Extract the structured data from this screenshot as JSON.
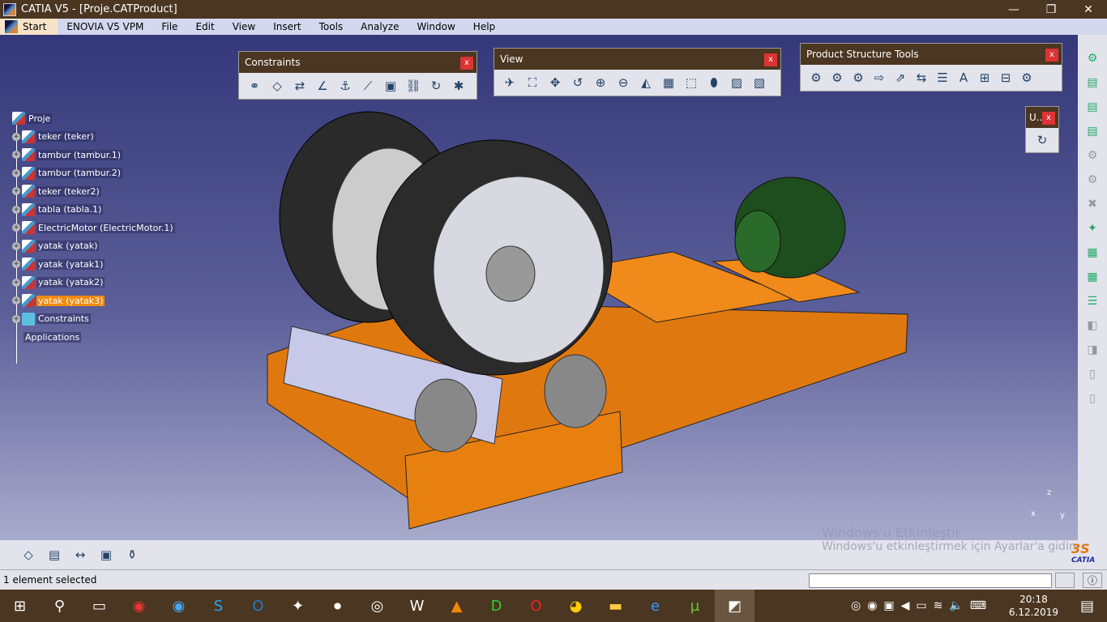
{
  "window": {
    "title": "CATIA V5 - [Proje.CATProduct]"
  },
  "menu": [
    "Start",
    "ENOVIA V5 VPM",
    "File",
    "Edit",
    "View",
    "Insert",
    "Tools",
    "Analyze",
    "Window",
    "Help"
  ],
  "tree": {
    "root": "Proje",
    "items": [
      "teker (teker)",
      "tambur (tambur.1)",
      "tambur (tambur.2)",
      "teker (teker2)",
      "tabla (tabla.1)",
      "ElectricMotor (ElectricMotor.1)",
      "yatak (yatak)",
      "yatak (yatak1)",
      "yatak (yatak2)",
      "yatak (yatak3)",
      "Constraints"
    ],
    "selected": "yatak (yatak3)",
    "applications": "Applications"
  },
  "toolbars": {
    "constraints": "Constraints",
    "view": "View",
    "product_structure": "Product Structure Tools",
    "u": "U..",
    "close": "x"
  },
  "compass": {
    "z": "z",
    "x": "x",
    "y": "y"
  },
  "watermark": {
    "line1": "Windows'u Etkinleştir",
    "line2": "Windows'u etkinleştirmek için Ayarlar'a gidin."
  },
  "brand": "CATIA",
  "status": {
    "text": "1 element selected",
    "input": ""
  },
  "clock": {
    "time": "20:18",
    "date": "6.12.2019"
  },
  "colors": {
    "titlebar": "#4b3621",
    "selection": "#f08a10",
    "frame": "#e07810"
  }
}
